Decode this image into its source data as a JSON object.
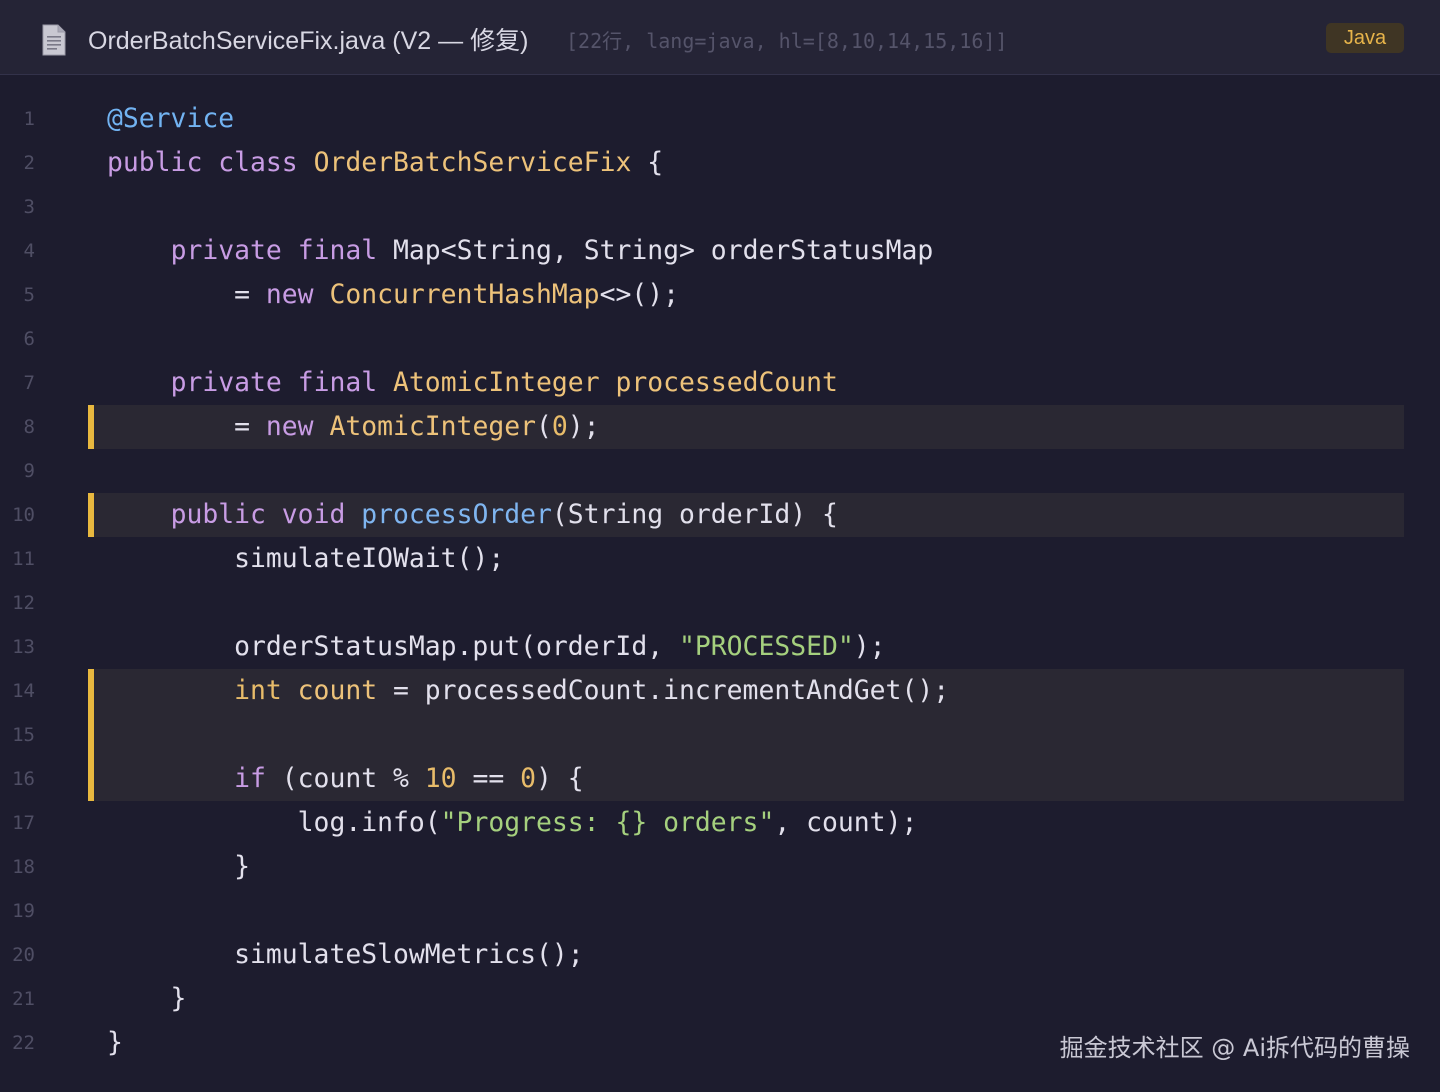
{
  "header": {
    "file_icon": "document-icon",
    "title": "OrderBatchServiceFix.java (V2 — 修复)",
    "meta": "[22行, lang=java, hl=[8,10,14,15,16]]",
    "language": "Java"
  },
  "colors": {
    "background": "#1d1c2e",
    "header_background": "#252436",
    "line_number": "#4f4e64",
    "text": "#e2e0ec",
    "keyword": "#c89ce4",
    "type": "#edc27a",
    "function": "#7fb5f0",
    "string": "#a5d07e",
    "number": "#e8bc6a",
    "annotation": "#72b3f2",
    "highlight_bar": "#e8b83f",
    "highlight_background": "#2a2833",
    "badge_background": "#3f3524",
    "badge_text": "#e7b44a"
  },
  "code": {
    "highlighted_lines": [
      8,
      10,
      14,
      15,
      16
    ],
    "lines": [
      {
        "n": "1",
        "text": "@Service"
      },
      {
        "n": "2",
        "text": "public class OrderBatchServiceFix {"
      },
      {
        "n": "3",
        "text": ""
      },
      {
        "n": "4",
        "text": "    private final Map<String, String> orderStatusMap"
      },
      {
        "n": "5",
        "text": "        = new ConcurrentHashMap<>();"
      },
      {
        "n": "6",
        "text": ""
      },
      {
        "n": "7",
        "text": "    private final AtomicInteger processedCount"
      },
      {
        "n": "8",
        "text": "        = new AtomicInteger(0);"
      },
      {
        "n": "9",
        "text": ""
      },
      {
        "n": "10",
        "text": "    public void processOrder(String orderId) {"
      },
      {
        "n": "11",
        "text": "        simulateIOWait();"
      },
      {
        "n": "12",
        "text": ""
      },
      {
        "n": "13",
        "text": "        orderStatusMap.put(orderId, \"PROCESSED\");"
      },
      {
        "n": "14",
        "text": "        int count = processedCount.incrementAndGet();"
      },
      {
        "n": "15",
        "text": ""
      },
      {
        "n": "16",
        "text": "        if (count % 10 == 0) {"
      },
      {
        "n": "17",
        "text": "            log.info(\"Progress: {} orders\", count);"
      },
      {
        "n": "18",
        "text": "        }"
      },
      {
        "n": "19",
        "text": ""
      },
      {
        "n": "20",
        "text": "        simulateSlowMetrics();"
      },
      {
        "n": "21",
        "text": "    }"
      },
      {
        "n": "22",
        "text": "}"
      }
    ]
  },
  "watermark": "掘金技术社区 @ Ai拆代码的曹操"
}
